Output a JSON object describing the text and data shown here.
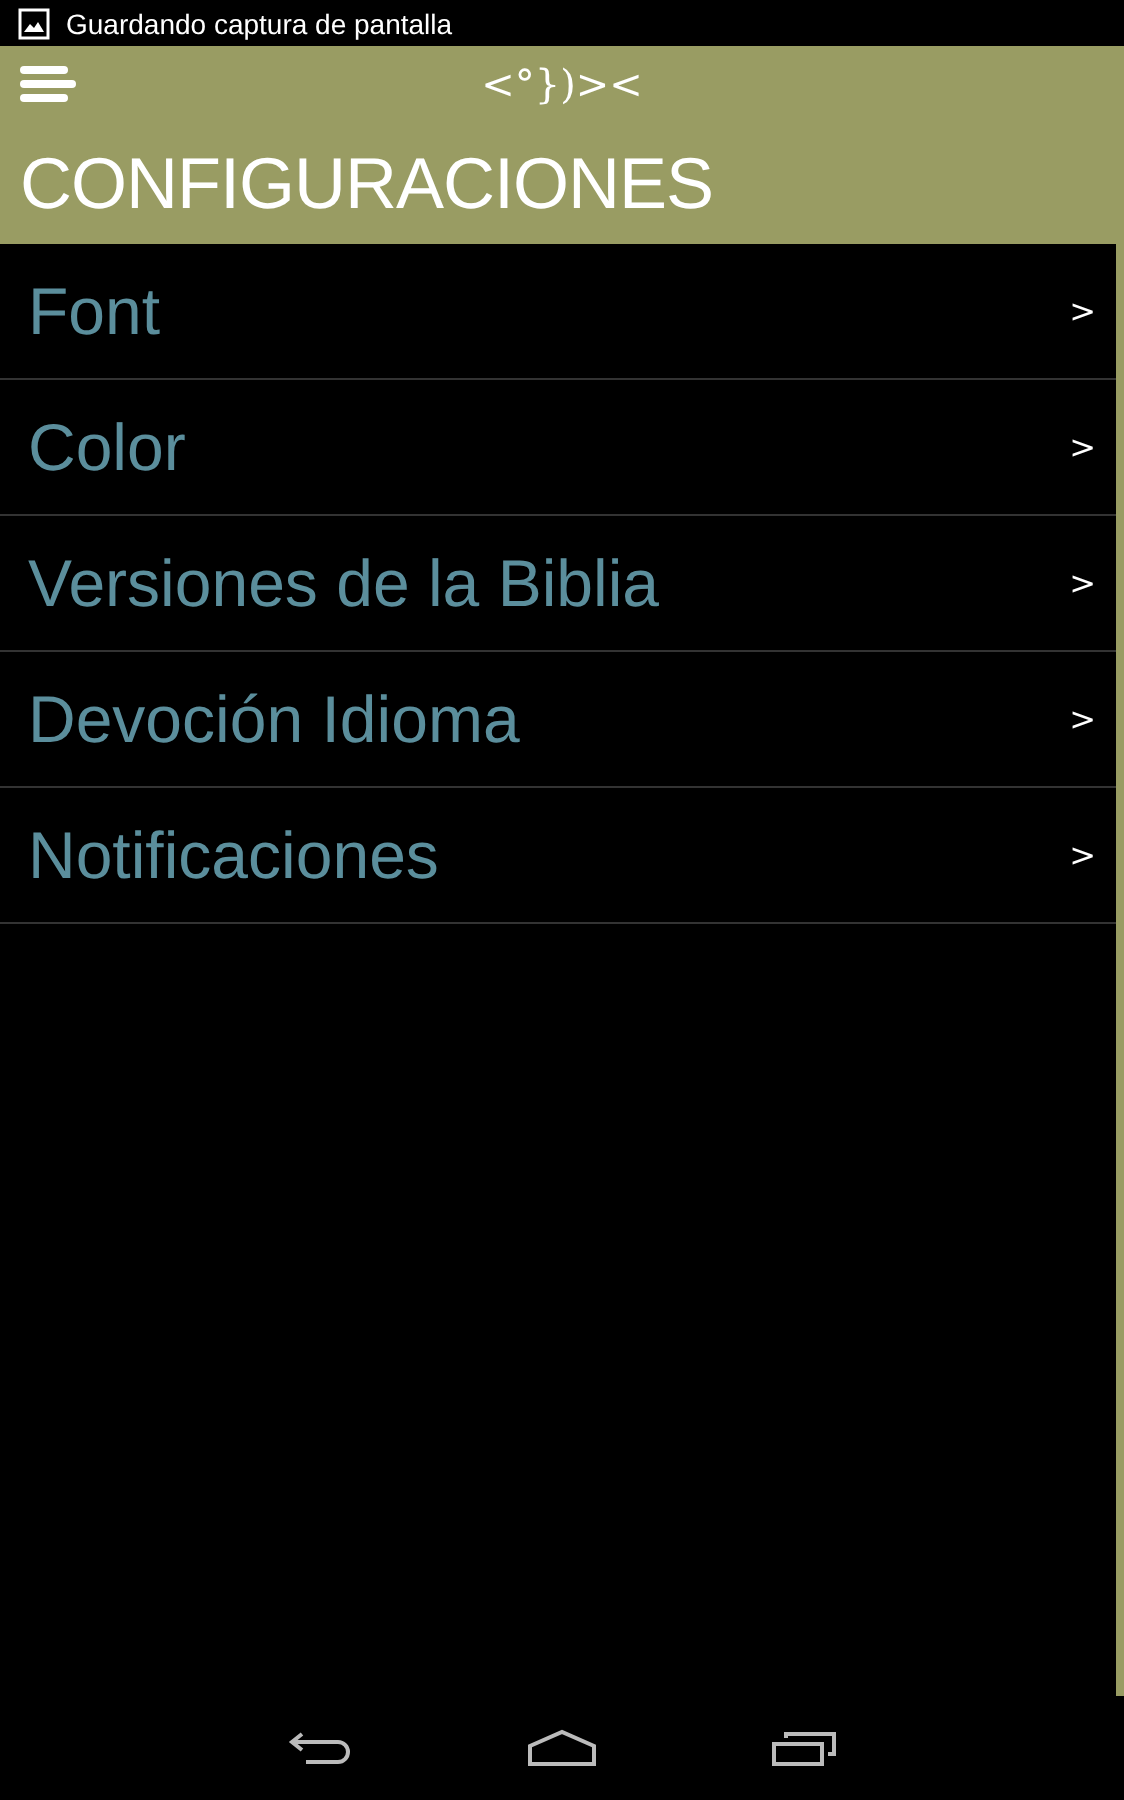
{
  "status_bar": {
    "notification": "Guardando captura de pantalla"
  },
  "header": {
    "logo": "<°})><",
    "title": "CONFIGURACIONES"
  },
  "settings": [
    {
      "label": "Font",
      "chevron": ">"
    },
    {
      "label": "Color",
      "chevron": ">"
    },
    {
      "label": "Versiones de la Biblia",
      "chevron": ">"
    },
    {
      "label": "Devoción Idioma",
      "chevron": ">"
    },
    {
      "label": "Notificaciones",
      "chevron": ">"
    }
  ]
}
